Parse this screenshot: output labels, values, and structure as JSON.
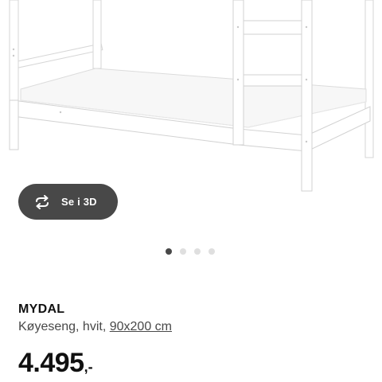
{
  "viewer": {
    "button_label": "Se i 3D",
    "button_icon": "rotate-arrows-icon"
  },
  "gallery": {
    "dot_count": 4,
    "active_index": 0
  },
  "product": {
    "name": "MYDAL",
    "description_prefix": "Køyeseng, hvit, ",
    "size_link": "90x200 cm",
    "price_amount": "4.495",
    "price_suffix": ",-"
  },
  "colors": {
    "button_bg": "#484848",
    "active_dot": "#484848",
    "inactive_dot": "#dfdfdf",
    "text_primary": "#111111",
    "text_secondary": "#484848"
  }
}
